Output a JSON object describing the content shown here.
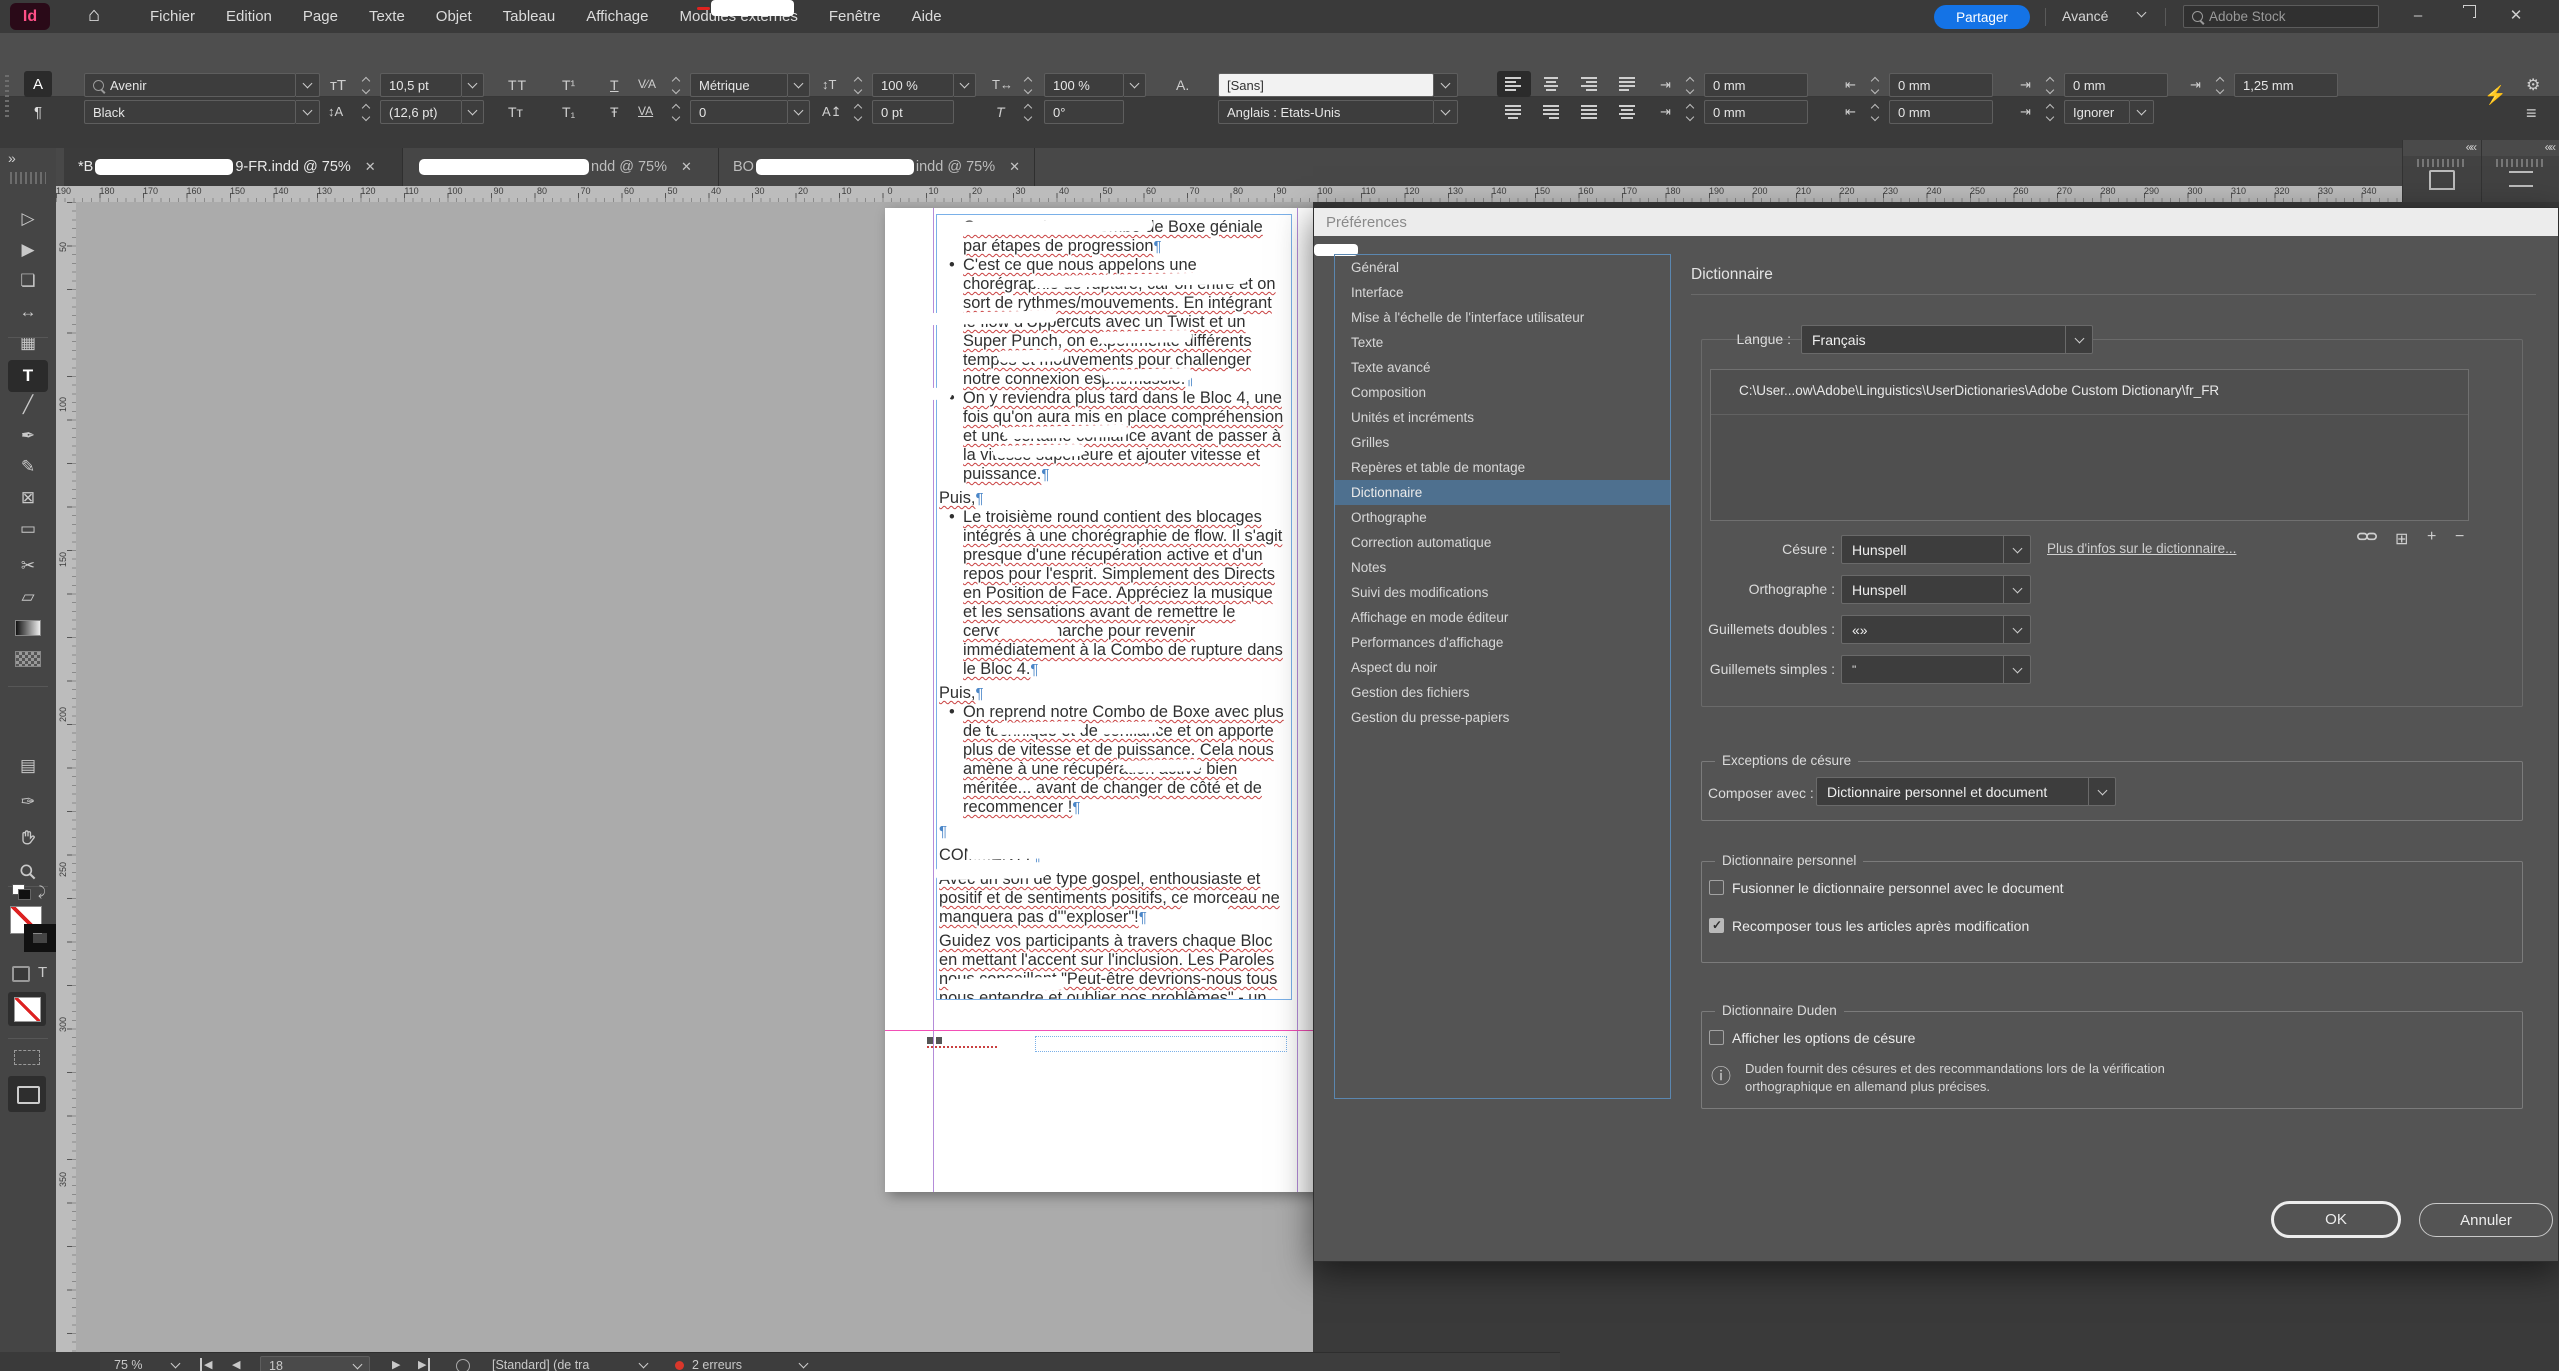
{
  "window": {
    "minimize_label": "–",
    "close_label": "✕"
  },
  "menubar": {
    "logo": "Id",
    "items": [
      "Fichier",
      "Edition",
      "Page",
      "Texte",
      "Objet",
      "Tableau",
      "Affichage",
      "Modules externes",
      "Fenêtre",
      "Aide"
    ],
    "share": "Partager",
    "advanced": "Avancé",
    "search_placeholder": "Adobe Stock"
  },
  "cpanel": {
    "character_icon": "A",
    "paragraph_icon": "¶",
    "font_family": "Avenir",
    "font_style": "Black",
    "font_size": "10,5 pt",
    "leading": "(12,6 pt)",
    "kerning": "Métrique",
    "tracking": "0",
    "vertical_scale": "100 %",
    "horizontal_scale": "100 %",
    "baseline_shift": "0 pt",
    "skew": "0°",
    "char_style": "[Sans]",
    "language": "Anglais : Etats-Unis",
    "indent_row1": [
      "0 mm",
      "0 mm",
      "0 mm",
      "1,25 mm"
    ],
    "indent_row2": [
      "0 mm",
      "0 mm"
    ],
    "dropcap_lines": "Ignorer"
  },
  "tabs": [
    {
      "prefix": "*B",
      "suffix": "9-FR.indd @ 75%",
      "redact_w": 138,
      "active": true,
      "closable": true
    },
    {
      "prefix": "",
      "suffix": "ndd @ 75%",
      "redact_w": 170,
      "active": false,
      "closable": true
    },
    {
      "prefix": "BO",
      "suffix": "indd @ 75%",
      "redact_w": 160,
      "active": false,
      "closable": true
    }
  ],
  "hruler": {
    "start": 190,
    "min": 0,
    "max": 360,
    "step": 10
  },
  "vruler": {
    "numbers": [
      "50",
      "100",
      "150",
      "200",
      "250",
      "300",
      "350"
    ]
  },
  "tools": [
    {
      "name": "selection-tool",
      "glyph": "▷"
    },
    {
      "name": "direct-selection-tool",
      "glyph": "▶"
    },
    {
      "name": "page-tool",
      "glyph": "❏"
    },
    {
      "name": "gap-tool",
      "glyph": "↔"
    },
    {
      "name": "content-collector-tool",
      "glyph": "▦"
    },
    {
      "name": "type-tool",
      "glyph": "T",
      "active": true
    },
    {
      "name": "line-tool",
      "glyph": "╱"
    },
    {
      "name": "pen-tool",
      "glyph": "✒"
    },
    {
      "name": "pencil-tool",
      "glyph": "✎"
    },
    {
      "name": "frame-tool",
      "glyph": "⊠"
    },
    {
      "name": "rectangle-tool",
      "glyph": "▭"
    },
    {
      "name": "scissors-tool",
      "glyph": "✂"
    },
    {
      "name": "free-transform-tool",
      "glyph": "▱"
    },
    {
      "name": "gradient-tool",
      "glyph": "@gradient"
    },
    {
      "name": "gradient-feather-tool",
      "glyph": "@feather"
    },
    {
      "name": "note-tool",
      "glyph": "▤"
    },
    {
      "name": "eyedropper-tool",
      "glyph": "✑"
    },
    {
      "name": "hand-tool",
      "glyph": "@hand"
    },
    {
      "name": "zoom-tool",
      "glyph": "@zoom"
    }
  ],
  "prefs": {
    "title": "Préférences",
    "sections": [
      "Général",
      "Interface",
      "Mise à l'échelle de l'interface utilisateur",
      "Texte",
      "Texte avancé",
      "Composition",
      "Unités et incréments",
      "Grilles",
      "Repères et table de montage",
      "Dictionnaire",
      "Orthographe",
      "Correction automatique",
      "Notes",
      "Suivi des modifications",
      "Affichage en mode éditeur",
      "Performances d'affichage",
      "Aspect du noir",
      "Gestion des fichiers",
      "Gestion du presse-papiers"
    ],
    "selected_index": 9,
    "panel": {
      "heading": "Dictionnaire",
      "langue_label": "Langue :",
      "langue_value": "Français",
      "dict_path": "C:\\User...ow\\Adobe\\Linguistics\\UserDictionaries\\Adobe Custom Dictionary\\fr_FR",
      "cesure_label": "Césure :",
      "cesure_value": "Hunspell",
      "more_link": "Plus d'infos sur le dictionnaire...",
      "ortho_label": "Orthographe :",
      "ortho_value": "Hunspell",
      "gdbl_label": "Guillemets doubles :",
      "gdbl_value": "«»",
      "gsmp_label": "Guillemets simples :",
      "gsmp_value": "''",
      "exc_legend": "Exceptions de césure",
      "composer_label": "Composer avec :",
      "composer_value": "Dictionnaire personnel et document",
      "perso_legend": "Dictionnaire personnel",
      "cb_fusionner": "Fusionner le dictionnaire personnel avec le document",
      "cb_recomposer": "Recomposer tous les articles après modification",
      "duden_legend": "Dictionnaire Duden",
      "cb_afficher": "Afficher les options de césure",
      "duden_info_1": "Duden fournit des césures et des recommandations lors de la vérification",
      "duden_info_2": "orthographique en allemand plus précises.",
      "ok": "OK",
      "cancel": "Annuler"
    }
  },
  "document": {
    "paragraphs": [
      {
        "type": "bullet",
        "text": "On construit une Combo de Boxe géniale par étapes de progression"
      },
      {
        "type": "bullet",
        "text": "C'est ce que nous appelons une chorégraphie de rupture, car on entre et on sort de rythmes/mouvements. En intégrant le flow d'Uppercuts avec un Twist et un Super Punch, on expérimente différents tempos et mouvements pour challenger notre connexion esprit/muscle."
      },
      {
        "type": "bullet",
        "text": "On y reviendra plus tard dans le Bloc 4, une fois qu'on aura mis en place compréhension et une certaine confiance avant de passer à la vitesse supérieure et ajouter vitesse et puissance."
      },
      {
        "type": "plain",
        "text": "Puis,"
      },
      {
        "type": "bullet",
        "text": "Le troisième round contient des blocages intégrés à une chorégraphie de flow. Il s'agit presque d'une récupération active et d'un repos pour l'esprit. Simplement des Directs en Position de Face. Appréciez la musique et les sensations avant de remettre le cerveau en marche pour revenir immédiatement à la Combo de rupture dans le Bloc 4."
      },
      {
        "type": "plain",
        "text": "Puis,"
      },
      {
        "type": "bullet",
        "text": "On reprend notre Combo de Boxe avec plus de technique et de confiance et on apporte plus de vitesse et de puissance. Cela nous amène à une récupération active bien méritée... avant de changer de côté et de recommencer !"
      },
      {
        "type": "plain",
        "text": ""
      },
      {
        "type": "heading",
        "text": "COMMENT?"
      },
      {
        "type": "plain",
        "text": "Avec un son de type gospel, enthousiaste et positif et de sentiments positifs, ce morceau ne manquera pas d'\"exploser\"!"
      },
      {
        "type": "plain",
        "text": "Guidez vos participants à travers chaque Bloc en mettant l'accent sur l'inclusion. Les Paroles nous conseillent \"Peut-être devrions-nous tous nous entendre et oublier nos problèmes\" - un crédo parfait pour ce superbe morceau. La dose"
      }
    ]
  },
  "statusbar": {
    "zoom_level": "75 %",
    "page_number": "18",
    "preflight_profile": "[Standard] (de tra",
    "errors": "2 erreurs"
  },
  "colors": {
    "accent_blue": "#1473e6",
    "list_selection": "#4e708f",
    "guide_violet": "#b48cd9",
    "guide_magenta": "#f24fb6",
    "frame_blue": "#7ab0e8",
    "squiggle_red": "#c94040",
    "logo_pink": "#ff4f87",
    "error_red": "#d9372b"
  }
}
